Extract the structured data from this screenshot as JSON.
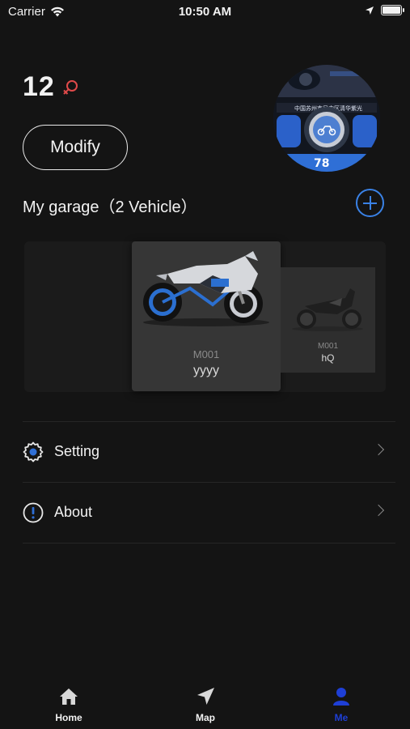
{
  "status_bar": {
    "carrier": "Carrier",
    "time": "10:50 AM"
  },
  "profile": {
    "user_id": "12",
    "gender_icon": "female-symbol-icon",
    "modify_label": "Modify"
  },
  "avatar": {
    "location_text": "中国苏州市吴中区清华紫光",
    "speed_text": "78"
  },
  "garage": {
    "title": "My garage（2 Vehicle）",
    "vehicles": [
      {
        "model": "M001",
        "name": "yyyy"
      },
      {
        "model": "M001",
        "name": "hQ"
      }
    ]
  },
  "menu": [
    {
      "label": "Setting",
      "icon": "gear-icon"
    },
    {
      "label": "About",
      "icon": "info-icon"
    }
  ],
  "tabbar": {
    "tabs": [
      {
        "label": "Home",
        "icon": "home-icon"
      },
      {
        "label": "Map",
        "icon": "navigation-arrow-icon"
      },
      {
        "label": "Me",
        "icon": "person-icon"
      }
    ],
    "active_tab": "Me"
  },
  "colors": {
    "background": "#141414",
    "accent": "#3a82e6",
    "active_tab": "#1e3fd6",
    "gender_icon": "#e04a4a"
  }
}
